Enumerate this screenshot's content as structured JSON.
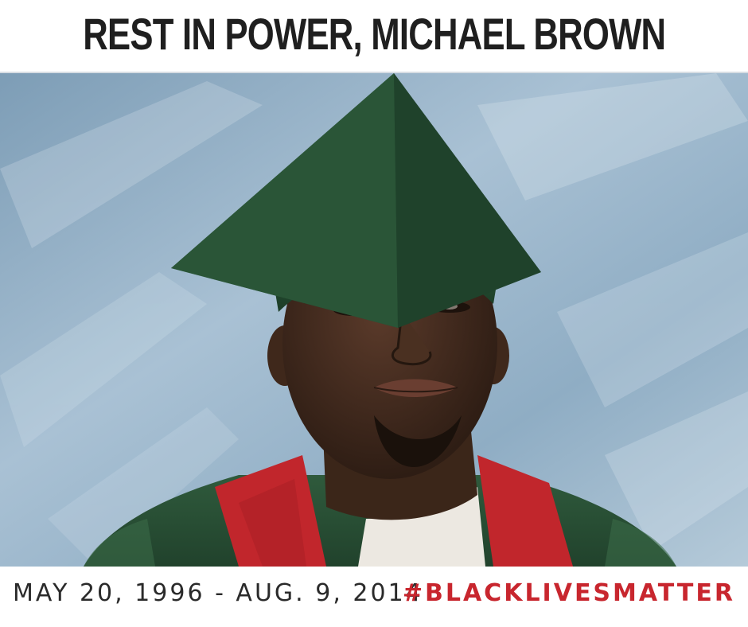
{
  "header": {
    "title": "REST IN POWER, MICHAEL BROWN"
  },
  "photo": {
    "subject": "graduation-portrait"
  },
  "footer": {
    "dates": "MAY 20, 1996 - AUG. 9, 2014",
    "hashtag": "#BLACKLIVESMATTER"
  },
  "colors": {
    "title": "#1f1f1f",
    "dates": "#2a2a2a",
    "hashtag": "#c8262e",
    "backdrop": "#9fb8cc",
    "gown": "#2f5a3c",
    "stole": "#c1262c"
  }
}
